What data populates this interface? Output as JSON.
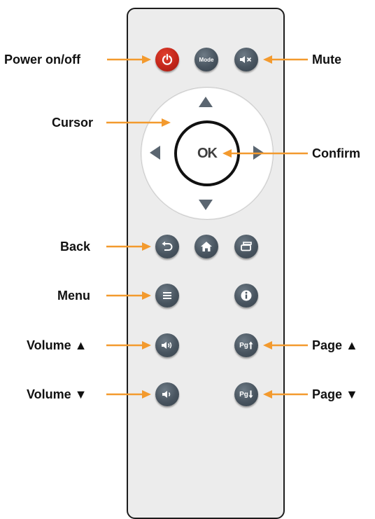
{
  "labels": {
    "power": "Power on/off",
    "mute": "Mute",
    "cursor": "Cursor",
    "confirm": "Confirm",
    "back": "Back",
    "menu": "Menu",
    "volume_up": "Volume ▲",
    "volume_down": "Volume ▼",
    "page_up": "Page ▲",
    "page_down": "Page ▼"
  },
  "buttons": {
    "mode": "Mode",
    "ok": "OK",
    "page_up": "Pg",
    "page_down": "Pg"
  },
  "colors": {
    "callout_arrow": "#f39a2e",
    "power_button": "#c3261a",
    "button": "#48545f",
    "remote_body": "#ececec"
  },
  "icons": [
    "power-icon",
    "mute-icon",
    "back-icon",
    "home-icon",
    "window-icon",
    "menu-icon",
    "info-icon",
    "volume-up-icon",
    "volume-down-icon",
    "page-up-icon",
    "page-down-icon"
  ]
}
